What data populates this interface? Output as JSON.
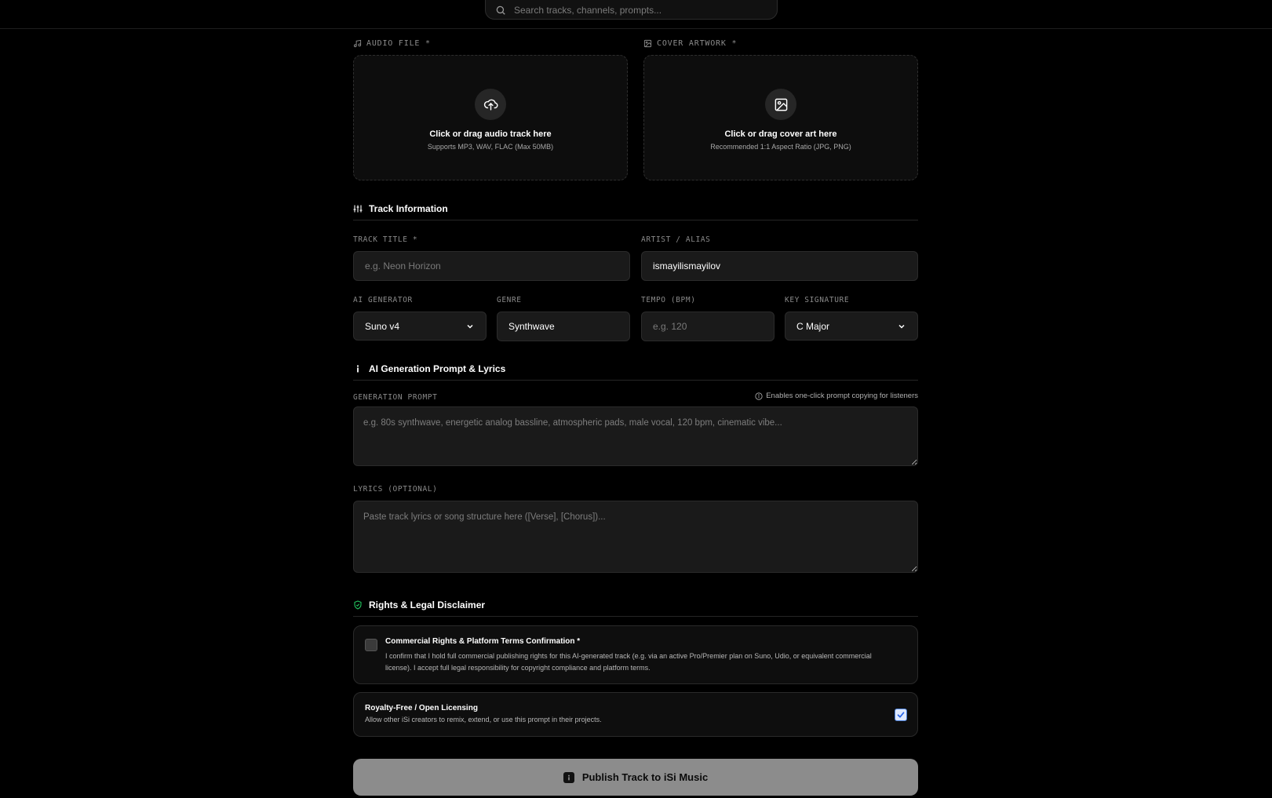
{
  "search": {
    "placeholder": "Search tracks, channels, prompts..."
  },
  "uploads": {
    "audio": {
      "label": "AUDIO FILE *",
      "title": "Click or drag audio track here",
      "subtitle": "Supports MP3, WAV, FLAC (Max 50MB)"
    },
    "cover": {
      "label": "COVER ARTWORK *",
      "title": "Click or drag cover art here",
      "subtitle": "Recommended 1:1 Aspect Ratio (JPG, PNG)"
    }
  },
  "track_info": {
    "heading": "Track Information",
    "title": {
      "label": "TRACK TITLE *",
      "placeholder": "e.g. Neon Horizon",
      "value": ""
    },
    "artist": {
      "label": "ARTIST / ALIAS",
      "value": "ismayilismayilov"
    },
    "generator": {
      "label": "AI GENERATOR",
      "value": "Suno v4"
    },
    "genre": {
      "label": "GENRE",
      "value": "Synthwave"
    },
    "tempo": {
      "label": "TEMPO (BPM)",
      "placeholder": "e.g. 120",
      "value": ""
    },
    "key": {
      "label": "KEY SIGNATURE",
      "value": "C Major"
    }
  },
  "prompt_section": {
    "heading": "AI Generation Prompt & Lyrics",
    "prompt_label": "GENERATION PROMPT",
    "prompt_hint": "Enables one-click prompt copying for listeners",
    "prompt_placeholder": "e.g. 80s synthwave, energetic analog bassline, atmospheric pads, male vocal, 120 bpm, cinematic vibe...",
    "lyrics_label": "LYRICS (OPTIONAL)",
    "lyrics_placeholder": "Paste track lyrics or song structure here ([Verse], [Chorus])..."
  },
  "rights": {
    "heading": "Rights & Legal Disclaimer",
    "commercial": {
      "title": "Commercial Rights & Platform Terms Confirmation *",
      "line1": "I confirm that I hold full commercial publishing rights for this AI-generated track (e.g. via an active Pro/Premier plan on Suno, Udio, or equivalent commercial",
      "line2": "license). I accept full legal responsibility for copyright compliance and platform terms.",
      "checked": false
    },
    "royalty": {
      "title": "Royalty-Free / Open Licensing",
      "desc": "Allow other iSi creators to remix, extend, or use this prompt in their projects.",
      "checked": true
    }
  },
  "publish_label": "Publish Track to iSi Music",
  "colors": {
    "accent_green": "#22c55e",
    "checkbox_blue": "#4a7fd8"
  }
}
